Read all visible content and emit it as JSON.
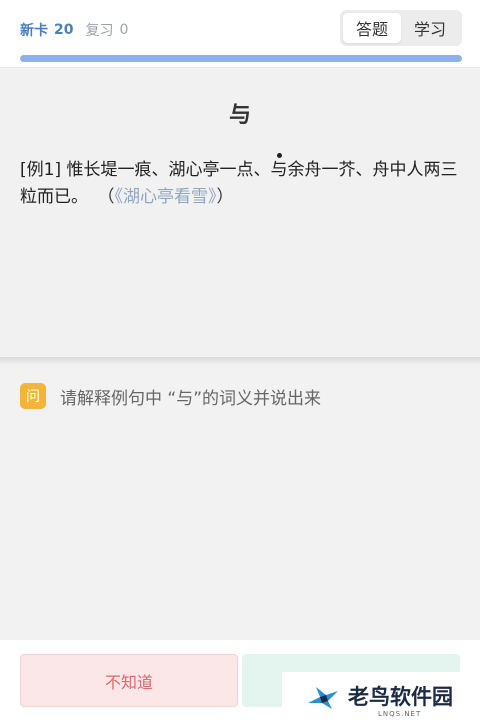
{
  "header": {
    "new_label": "新卡",
    "new_count": "20",
    "review_label": "复习",
    "review_count": "0",
    "tabs": [
      {
        "label": "答题",
        "active": true
      },
      {
        "label": "学习",
        "active": false
      }
    ],
    "progress": 1.0
  },
  "card": {
    "word": "与",
    "example_prefix": "[例1] 惟长堤一痕、湖心亭一点、",
    "example_target": "与",
    "example_suffix": "余舟一芥、舟中人两三粒而已。",
    "source_open": "（",
    "source": "《湖心亭看雪》",
    "source_close": "）"
  },
  "question": {
    "icon_label": "问",
    "text": "请解释例句中 “与”的词义并说出来"
  },
  "footer": {
    "unknown_label": "不知道",
    "known_label": ""
  },
  "watermark": {
    "text": "老鸟软件园",
    "sub": "LNQS.NET"
  },
  "colors": {
    "accent": "#4a7fbf",
    "progress": "#8fb0e8",
    "question_icon": "#f3b43a",
    "unknown_bg": "#fbe7e7",
    "known_bg": "#e4f5ef"
  }
}
